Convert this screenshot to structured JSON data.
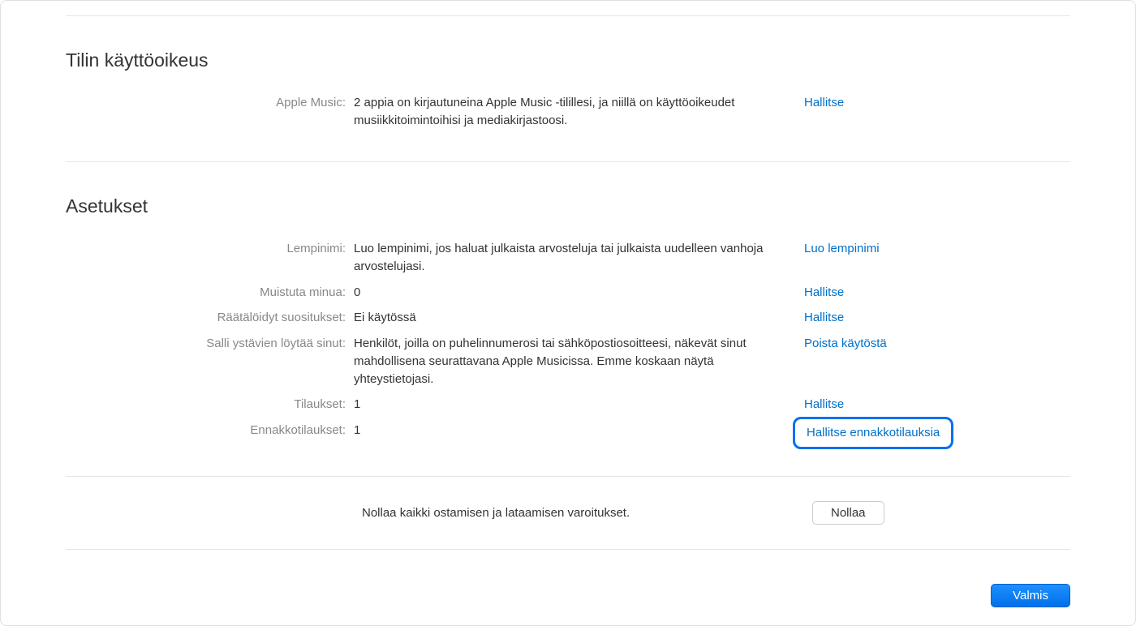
{
  "sections": {
    "access": {
      "title": "Tilin käyttöoikeus",
      "rows": {
        "appleMusic": {
          "label": "Apple Music:",
          "value": "2 appia on kirjautuneina Apple Music ‑tilillesi, ja niillä on käyttöoikeudet musiikkitoimintoihisi ja mediakirjastoosi.",
          "action": "Hallitse"
        }
      }
    },
    "settings": {
      "title": "Asetukset",
      "rows": {
        "nickname": {
          "label": "Lempinimi:",
          "value": "Luo lempinimi, jos haluat julkaista arvosteluja tai julkaista uudelleen vanhoja arvostelujasi.",
          "action": "Luo lempinimi"
        },
        "remind": {
          "label": "Muistuta minua:",
          "value": "0",
          "action": "Hallitse"
        },
        "personalized": {
          "label": "Räätälöidyt suositukset:",
          "value": "Ei käytössä",
          "action": "Hallitse"
        },
        "friends": {
          "label": "Salli ystävien löytää sinut:",
          "value": "Henkilöt, joilla on puhelinnumerosi tai sähköpostiosoitteesi, näkevät sinut mahdollisena seurattavana Apple Musicissa. Emme koskaan näytä yhteystietojasi.",
          "action": "Poista käytöstä"
        },
        "subscriptions": {
          "label": "Tilaukset:",
          "value": "1",
          "action": "Hallitse"
        },
        "preorders": {
          "label": "Ennakkotilaukset:",
          "value": "1",
          "action": "Hallitse ennakkotilauksia"
        }
      },
      "reset": {
        "text": "Nollaa kaikki ostamisen ja lataamisen varoitukset.",
        "button": "Nollaa"
      }
    }
  },
  "footer": {
    "done": "Valmis"
  }
}
